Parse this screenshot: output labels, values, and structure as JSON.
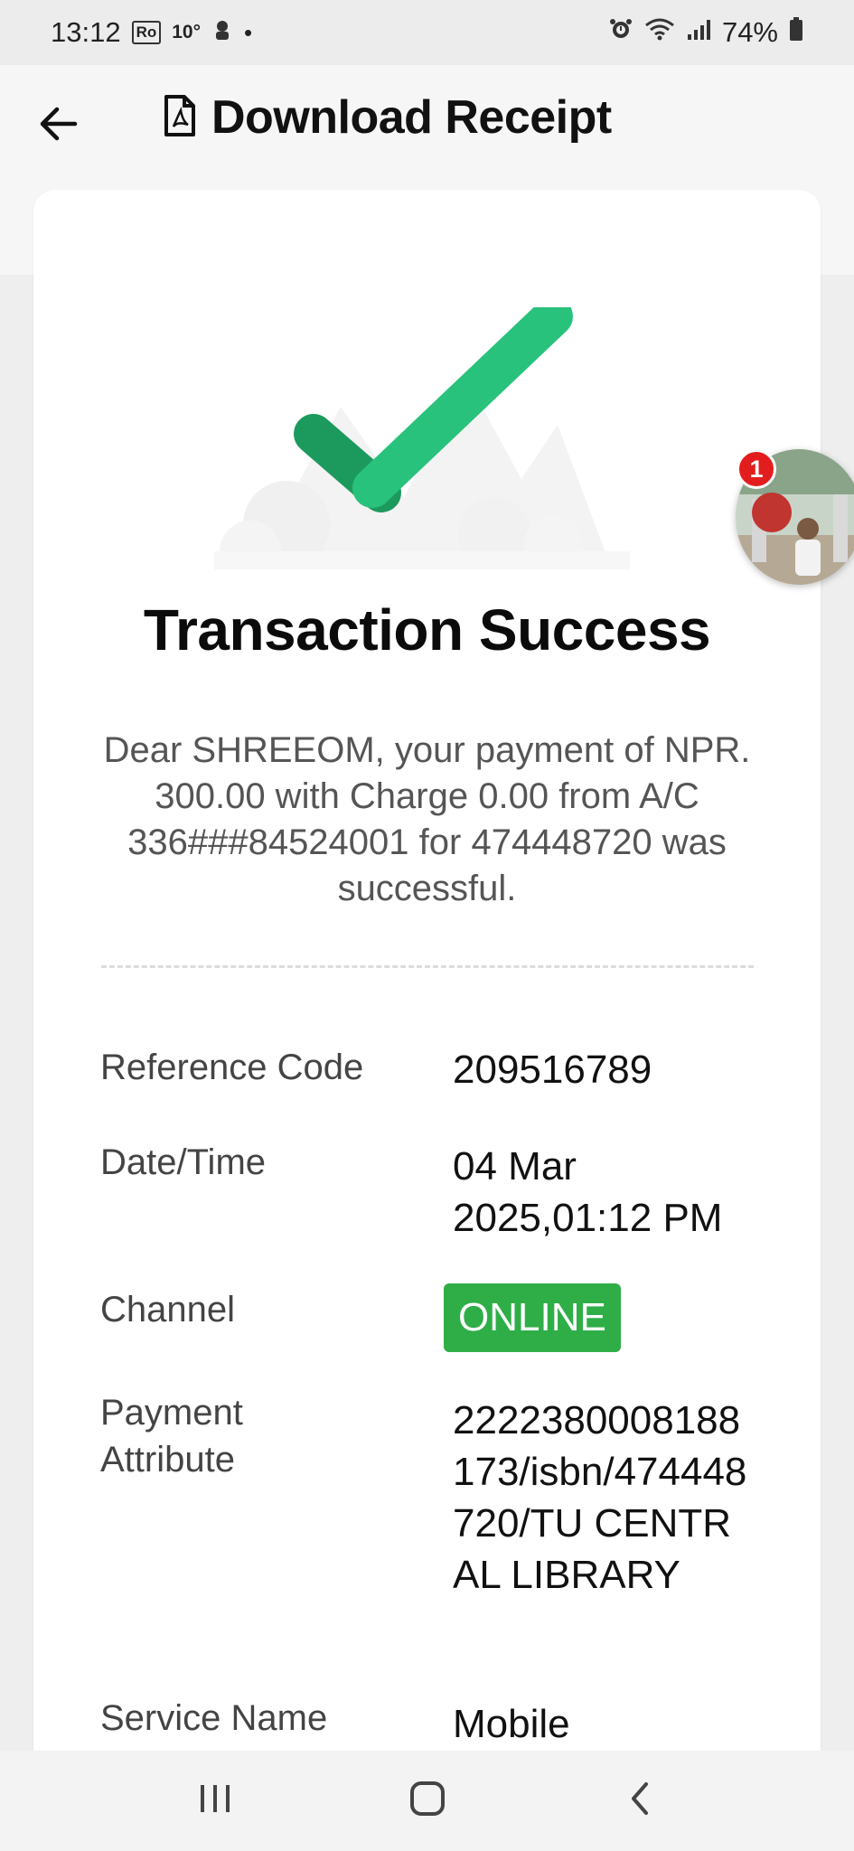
{
  "status_bar": {
    "time": "13:12",
    "ro_badge": "Ro",
    "temperature": "10°",
    "battery": "74%",
    "icons": [
      "app-notification-icon",
      "alarm-icon",
      "wifi-icon",
      "signal-icon",
      "battery-icon"
    ]
  },
  "app_bar": {
    "title": "Download Receipt",
    "back_icon": "arrow-left-icon",
    "title_icon": "pdf-file-icon"
  },
  "receipt": {
    "title": "Transaction Success",
    "message": "Dear SHREEOM, your payment of NPR. 300.00 with Charge 0.00 from A/C 336###84524001 for 474448720 was successful.",
    "rows": [
      {
        "label": "Reference Code",
        "value": "209516789"
      },
      {
        "label": "Date/Time",
        "value": "04 Mar 2025,01:12 PM"
      },
      {
        "label": "Channel",
        "value": "ONLINE"
      },
      {
        "label": "Payment Attribute",
        "value": "2222380008188173/isbn/474448720/TU CENTRAL LIBRARY"
      },
      {
        "label": "Service Name",
        "value": "Mobile"
      }
    ]
  },
  "chat_head": {
    "badge_count": "1"
  },
  "colors": {
    "success_green": "#2fae48",
    "check_dark": "#1c9a5e",
    "check_light": "#29c27c",
    "badge_red": "#e31d1d"
  }
}
